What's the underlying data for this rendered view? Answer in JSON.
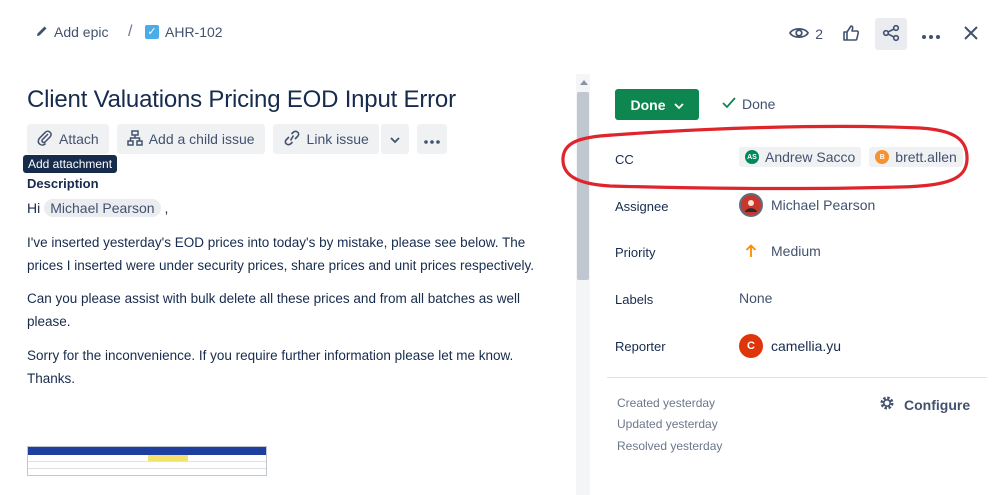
{
  "breadcrumb": {
    "epic_label": "Add epic",
    "separator": "/",
    "issue_key": "AHR-102"
  },
  "top_actions": {
    "watch_count": "2"
  },
  "issue": {
    "title": "Client Valuations Pricing EOD Input Error"
  },
  "toolbar": {
    "attach_label": "Attach",
    "child_issue_label": "Add a child issue",
    "link_issue_label": "Link issue",
    "tooltip": "Add attachment"
  },
  "description": {
    "label": "Description",
    "greeting": "Hi",
    "mention": "Michael Pearson",
    "greeting_suffix": ",",
    "para1": "I've inserted yesterday's EOD prices into today's by mistake, please see below. The prices I inserted were under security prices, share prices and unit prices respectively.",
    "para2": "Can you please assist with bulk delete all these prices and from all batches as well please.",
    "para3": "Sorry for the inconvenience. If you require further information please let me know. Thanks."
  },
  "status": {
    "button_label": "Done",
    "resolution": "Done"
  },
  "fields": {
    "cc_label": "CC",
    "cc_users": [
      {
        "initials": "AS",
        "name": "Andrew Sacco",
        "color": "#00875a"
      },
      {
        "initials": "B",
        "name": "brett.allen",
        "color": "#f79232"
      }
    ],
    "assignee_label": "Assignee",
    "assignee": "Michael Pearson",
    "priority_label": "Priority",
    "priority": "Medium",
    "labels_label": "Labels",
    "labels": "None",
    "reporter_label": "Reporter",
    "reporter_initial": "C",
    "reporter": "camellia.yu"
  },
  "meta": {
    "created": "Created yesterday",
    "updated": "Updated yesterday",
    "resolved": "Resolved yesterday",
    "configure_label": "Configure"
  },
  "colors": {
    "status_green": "#0e8650",
    "annotation_red": "#e0242b",
    "priority_orange": "#ff8b00",
    "reporter_avatar": "#de350b"
  }
}
